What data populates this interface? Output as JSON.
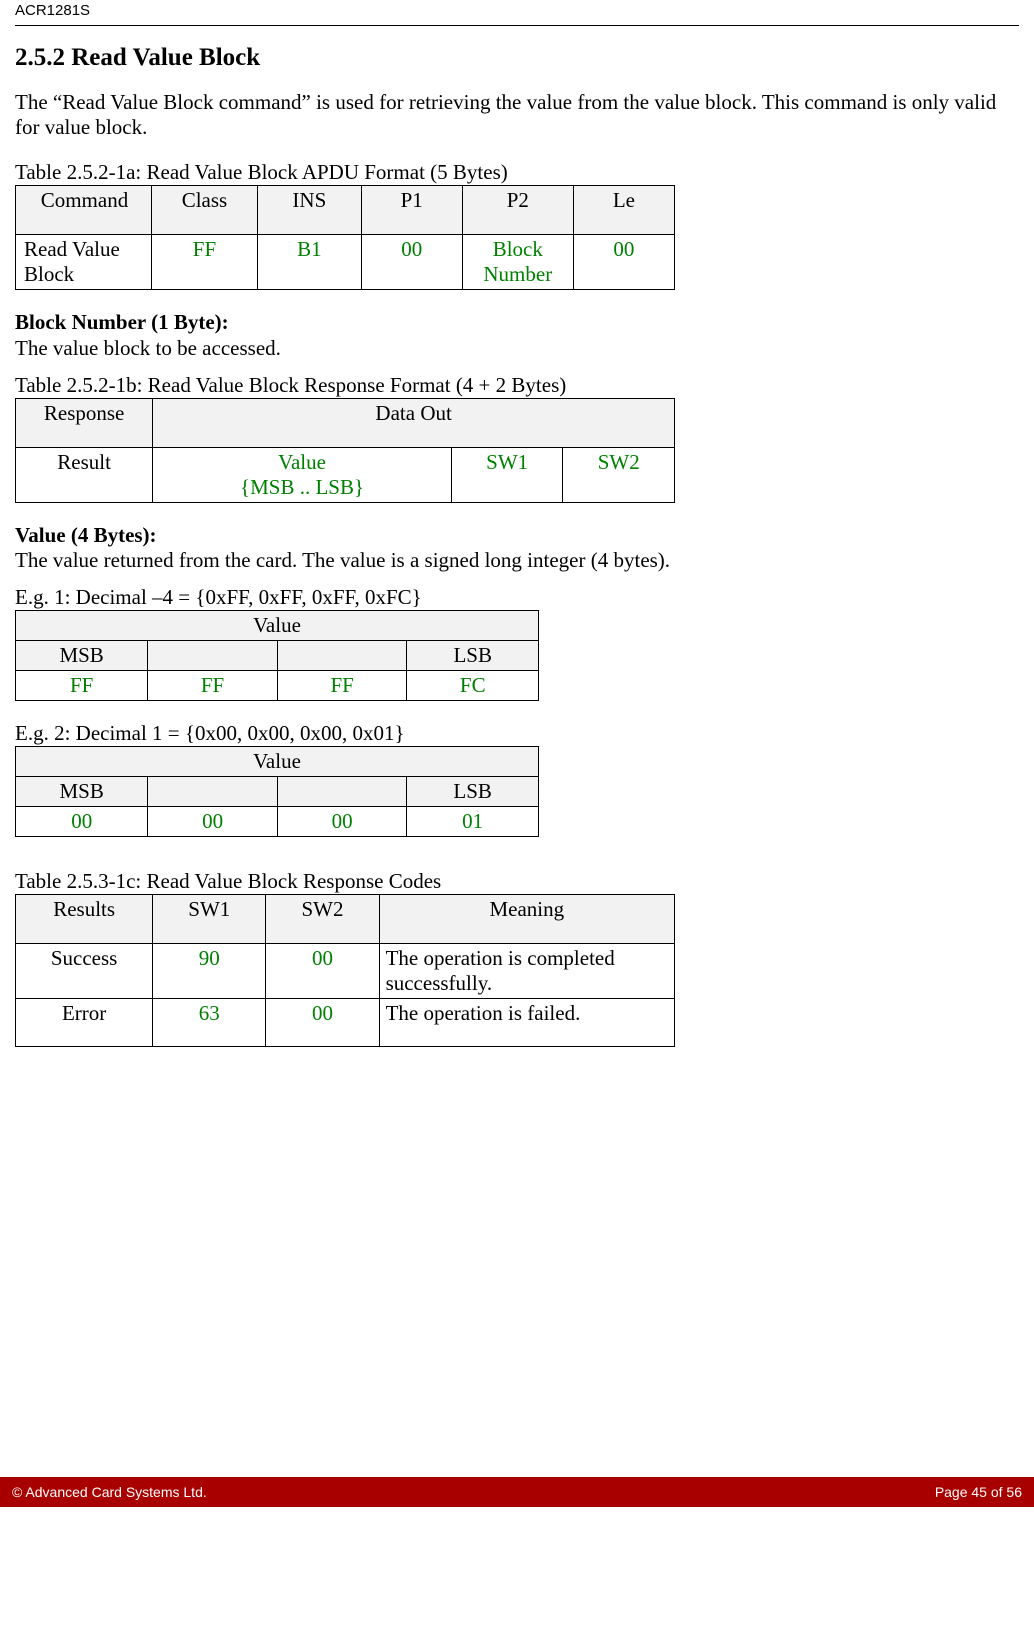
{
  "header": {
    "product": "ACR1281S"
  },
  "section": {
    "number": "2.5.2",
    "title": "Read Value Block",
    "intro": "The “Read Value Block command” is used for retrieving the value from the value block. This command is only valid for value block."
  },
  "table1": {
    "caption": "Table 2.5.2-1a: Read Value Block APDU Format (5 Bytes)",
    "headers": [
      "Command",
      "Class",
      "INS",
      "P1",
      "P2",
      "Le"
    ],
    "row": {
      "command": "Read Value Block",
      "class": "FF",
      "ins": "B1",
      "p1": "00",
      "p2": "Block Number",
      "le": "00"
    }
  },
  "block_number": {
    "label": "Block Number (1 Byte):",
    "desc": "The value block to be accessed."
  },
  "table2": {
    "caption": "Table 2.5.2-1b: Read Value Block Response Format (4 + 2 Bytes)",
    "h_response": "Response",
    "h_dataout": "Data Out",
    "result": "Result",
    "value_line1": "Value",
    "value_line2": "{MSB .. LSB}",
    "sw1": "SW1",
    "sw2": "SW2"
  },
  "value_block": {
    "label": "Value (4 Bytes):",
    "desc": "The value returned from the card. The value is a signed long integer (4 bytes)."
  },
  "eg1": {
    "caption": "E.g. 1: Decimal  –4 = {0xFF, 0xFF, 0xFF, 0xFC}",
    "title": "Value",
    "msb": "MSB",
    "lsb": "LSB",
    "v1": "FF",
    "v2": "FF",
    "v3": "FF",
    "v4": "FC"
  },
  "eg2": {
    "caption": "E.g. 2: Decimal 1 = {0x00, 0x00, 0x00, 0x01}",
    "title": "Value",
    "msb": "MSB",
    "lsb": "LSB",
    "v1": "00",
    "v2": "00",
    "v3": "00",
    "v4": "01"
  },
  "table4": {
    "caption": "Table 2.5.3-1c: Read Value Block Response Codes",
    "h_results": "Results",
    "h_sw1": "SW1",
    "h_sw2": "SW2",
    "h_meaning": "Meaning",
    "rows": [
      {
        "result": "Success",
        "sw1": "90",
        "sw2": "00",
        "meaning": "The operation is completed successfully."
      },
      {
        "result": "Error",
        "sw1": "63",
        "sw2": "00",
        "meaning": "The operation is failed."
      }
    ]
  },
  "footer": {
    "left": "© Advanced Card Systems Ltd.",
    "right": "Page 45 of 56"
  }
}
